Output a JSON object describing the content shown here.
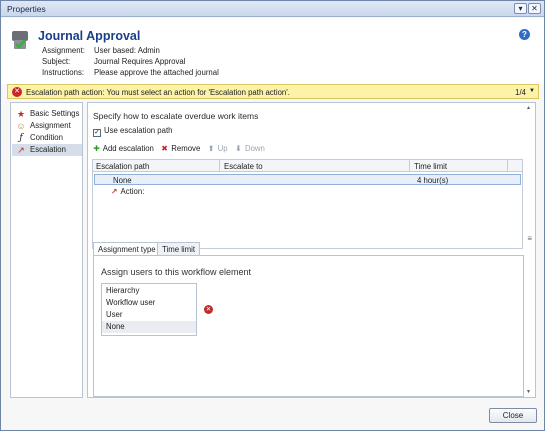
{
  "window": {
    "title": "Properties"
  },
  "header": {
    "title": "Journal Approval",
    "meta": [
      {
        "key": "Assignment:",
        "value": "User based: Admin"
      },
      {
        "key": "Subject:",
        "value": "Journal Requires Approval"
      },
      {
        "key": "Instructions:",
        "value": "Please approve the attached journal"
      }
    ]
  },
  "warning": {
    "text": "Escalation path action: You must select an action for 'Escalation path action'.",
    "count": "1/4"
  },
  "nav": {
    "items": [
      {
        "label": "Basic Settings",
        "icon": "star-icon"
      },
      {
        "label": "Assignment",
        "icon": "users-icon"
      },
      {
        "label": "Condition",
        "icon": "fx-icon"
      },
      {
        "label": "Escalation",
        "icon": "escalation-icon"
      }
    ],
    "selected": "Escalation"
  },
  "content": {
    "heading": "Specify how to escalate overdue work items",
    "use_escalation_label": "Use escalation path",
    "use_escalation_checked": true,
    "toolbar": {
      "add": "Add escalation",
      "remove": "Remove",
      "up": "Up",
      "down": "Down"
    },
    "grid": {
      "columns": [
        "Escalation path",
        "Escalate to",
        "Time limit"
      ],
      "row": {
        "path": "None",
        "escalate_to": "",
        "time_limit": "4 hour(s)"
      },
      "action_label": "Action:"
    },
    "tabs": [
      "Assignment type",
      "Time limit"
    ],
    "active_tab": "Assignment type",
    "panel": {
      "title": "Assign users to this workflow element",
      "options": [
        "Hierarchy",
        "Workflow user",
        "User",
        "None"
      ],
      "selected": "None"
    }
  },
  "footer": {
    "close": "Close"
  },
  "colors": {
    "title_blue": "#1a3f8a",
    "warning_bg": "#fcf2a8",
    "error_red": "#c9262c",
    "selection": "#e6effb"
  }
}
